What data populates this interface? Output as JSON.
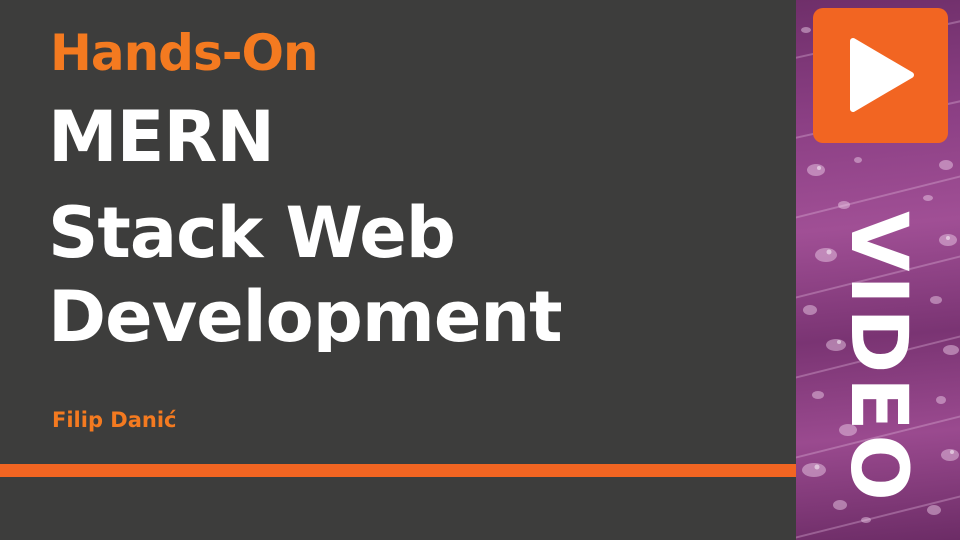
{
  "slide": {
    "subtitle": "Hands-On",
    "title_lines": [
      "MERN",
      "Stack Web",
      "Development"
    ],
    "author": "Filip Danić",
    "badge_word": "VIDEO"
  },
  "colors": {
    "background": "#3d3d3c",
    "accent_orange": "#f26522",
    "text_orange": "#f47a20",
    "title_white": "#ffffff",
    "side_panel_purple": "#8b3f84"
  },
  "icons": {
    "badge": "play-icon"
  }
}
